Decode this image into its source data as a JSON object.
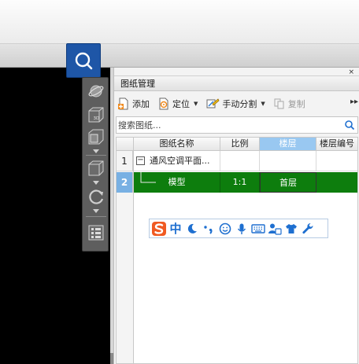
{
  "panel": {
    "title": "图纸管理",
    "close_glyph": "×",
    "toolbar": {
      "add_label": "添加",
      "locate_label": "定位",
      "manual_split_label": "手动分割",
      "copy_label": "复制",
      "more_glyph": "▸▸"
    },
    "search": {
      "placeholder": "搜索图纸..."
    },
    "table": {
      "headers": [
        "图纸名称",
        "比例",
        "楼层",
        "楼层编号"
      ],
      "rows": [
        {
          "index": "1",
          "name": "通风空调平面...",
          "scale": "",
          "floor": "",
          "floor_no": ""
        },
        {
          "index": "2",
          "name": "模型",
          "scale": "1:1",
          "floor": "首层",
          "floor_no": ""
        }
      ],
      "expand_glyph": "−"
    }
  },
  "ime": {
    "mode_label": "中"
  },
  "colors": {
    "accent_blue": "#1e56a7",
    "selected_row_green": "#0d7d0d",
    "selected_header": "#99c8f1",
    "ime_logo_orange": "#f05a22"
  },
  "icons": {
    "float_search": "magnifier-icon",
    "view_toolbar": [
      "orbit-icon",
      "3d-view-icon",
      "cube-front-icon",
      "cube-iso-icon",
      "rotate-icon",
      "layer-display-icon"
    ],
    "ime_tools": [
      "sogou-logo-icon",
      "moon-icon",
      "punctuation-icon",
      "smiley-icon",
      "microphone-icon",
      "keyboard-icon",
      "user-skin-icon",
      "shirt-icon",
      "wrench-icon"
    ]
  }
}
